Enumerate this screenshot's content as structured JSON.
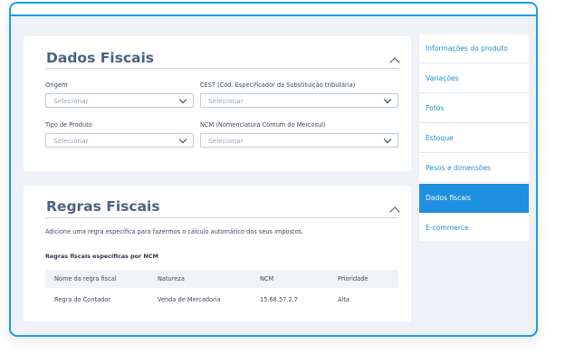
{
  "dados_fiscais": {
    "title": "Dados Fiscais",
    "fields": [
      {
        "label": "Origem",
        "placeholder": "Selecionar"
      },
      {
        "label": "CEST (Cód. Especificador da Substituição tributária)",
        "placeholder": "Selecionar"
      },
      {
        "label": "Tipo de Produto",
        "placeholder": "Selecionar"
      },
      {
        "label": "NCM (Nomenclatura Comum do Mercosul)",
        "placeholder": "Selecionar"
      }
    ]
  },
  "regras_fiscais": {
    "title": "Regras Fiscais",
    "description": "Adicione uma regra específica para fazermos o cálculo automático dos seus impostos.",
    "subheading": "Regras fiscais específicas por NCM",
    "columns": [
      "Nome da regra fiscal",
      "Natureza",
      "NCM",
      "Prioridade"
    ],
    "rows": [
      [
        "Regra do Contador",
        "Venda de Mercadoria",
        "15.68.57.2.7",
        "Alta"
      ]
    ]
  },
  "sidebar": {
    "items": [
      {
        "label": "Informações do produto",
        "active": false
      },
      {
        "label": "Variações",
        "active": false
      },
      {
        "label": "Fotos",
        "active": false
      },
      {
        "label": "Estoque",
        "active": false
      },
      {
        "label": "Pesos e dimensões",
        "active": false
      },
      {
        "label": "Dados fiscais",
        "active": true
      },
      {
        "label": "E-commerce",
        "active": false
      }
    ]
  },
  "colors": {
    "accent": "#1f8fe0",
    "frame_border": "#1f9de6",
    "title_text": "#4a6283",
    "background": "#eef1f6"
  }
}
